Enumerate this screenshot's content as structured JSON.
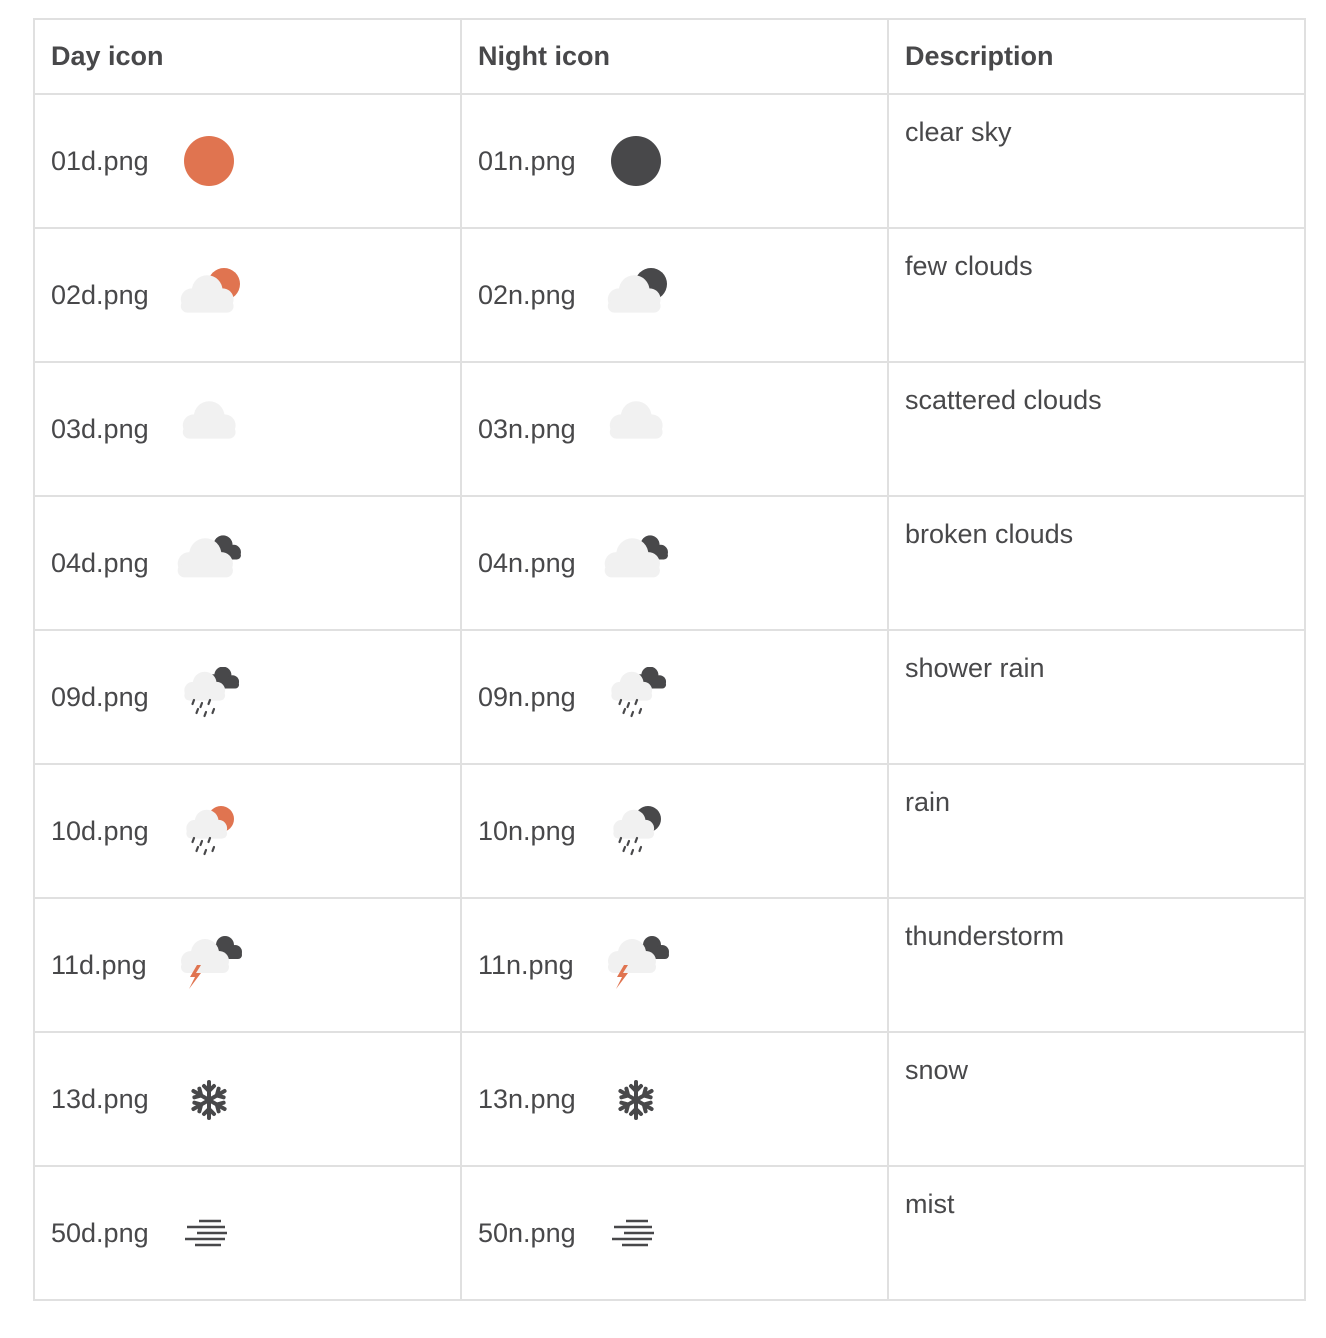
{
  "table": {
    "headers": {
      "day": "Day icon",
      "night": "Night icon",
      "description": "Description"
    },
    "rows": [
      {
        "day_file": "01d.png",
        "day_icon": "clear-sky-day-icon",
        "night_file": "01n.png",
        "night_icon": "clear-sky-night-icon",
        "description": "clear sky"
      },
      {
        "day_file": "02d.png",
        "day_icon": "few-clouds-day-icon",
        "night_file": "02n.png",
        "night_icon": "few-clouds-night-icon",
        "description": "few clouds"
      },
      {
        "day_file": "03d.png",
        "day_icon": "scattered-clouds-icon",
        "night_file": "03n.png",
        "night_icon": "scattered-clouds-icon",
        "description": "scattered clouds"
      },
      {
        "day_file": "04d.png",
        "day_icon": "broken-clouds-icon",
        "night_file": "04n.png",
        "night_icon": "broken-clouds-icon",
        "description": "broken clouds"
      },
      {
        "day_file": "09d.png",
        "day_icon": "shower-rain-icon",
        "night_file": "09n.png",
        "night_icon": "shower-rain-icon",
        "description": "shower rain"
      },
      {
        "day_file": "10d.png",
        "day_icon": "rain-day-icon",
        "night_file": "10n.png",
        "night_icon": "rain-night-icon",
        "description": "rain"
      },
      {
        "day_file": "11d.png",
        "day_icon": "thunderstorm-icon",
        "night_file": "11n.png",
        "night_icon": "thunderstorm-icon",
        "description": "thunderstorm"
      },
      {
        "day_file": "13d.png",
        "day_icon": "snow-icon",
        "night_file": "13n.png",
        "night_icon": "snow-icon",
        "description": "snow"
      },
      {
        "day_file": "50d.png",
        "day_icon": "mist-icon",
        "night_file": "50n.png",
        "night_icon": "mist-icon",
        "description": "mist"
      }
    ]
  },
  "colors": {
    "sun": "#e07450",
    "moon": "#48484a",
    "cloud": "#f1f1f1",
    "dark_cloud": "#48484a",
    "text": "#48484a",
    "border": "#e0e0e0"
  }
}
